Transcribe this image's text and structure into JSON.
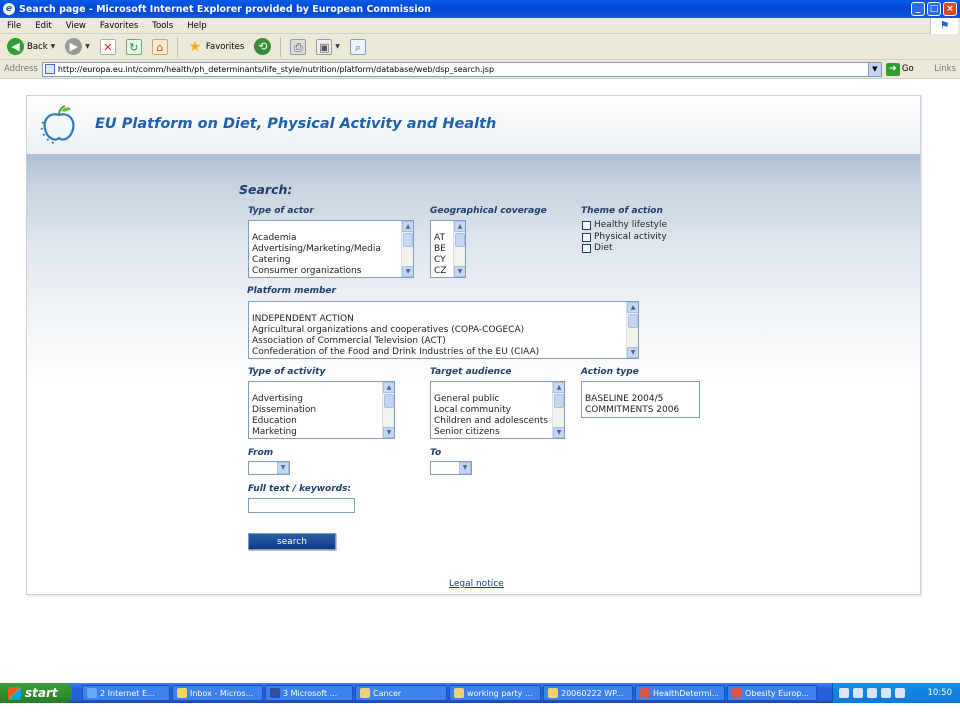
{
  "window": {
    "title": "Search page - Microsoft Internet Explorer provided by European Commission",
    "controls": [
      "_",
      "□",
      "×"
    ]
  },
  "menu": [
    "File",
    "Edit",
    "View",
    "Favorites",
    "Tools",
    "Help"
  ],
  "toolbar": {
    "back_label": "Back",
    "favorites_label": "Favorites"
  },
  "address": {
    "label": "Address",
    "url": "http://europa.eu.int/comm/health/ph_determinants/life_style/nutrition/platform/database/web/dsp_search.jsp",
    "go_label": "Go",
    "links_label": "Links"
  },
  "page": {
    "site_title": "EU Platform on Diet, Physical Activity and Health",
    "search_heading": "Search:",
    "type_of_actor": {
      "label": "Type of actor",
      "options": [
        "",
        "Academia",
        "Advertising/Marketing/Media",
        "Catering",
        "Consumer organizations"
      ]
    },
    "geographical_coverage": {
      "label": "Geographical coverage",
      "options": [
        "",
        "AT",
        "BE",
        "CY",
        "CZ"
      ]
    },
    "theme_of_action": {
      "label": "Theme of action",
      "options": [
        "Healthy lifestyle",
        "Physical activity",
        "Diet"
      ]
    },
    "platform_member": {
      "label": "Platform member",
      "options": [
        "",
        "INDEPENDENT ACTION",
        "Agricultural organizations and cooperatives (COPA-COGECA)",
        "Association of Commercial Television (ACT)",
        "Confederation of the Food and Drink Industries of the EU (CIAA)"
      ]
    },
    "type_of_activity": {
      "label": "Type of activity",
      "options": [
        "",
        "Advertising",
        "Dissemination",
        "Education",
        "Marketing"
      ]
    },
    "target_audience": {
      "label": "Target audience",
      "options": [
        "",
        "General public",
        "Local community",
        "Children and adolescents",
        "Senior citizens"
      ]
    },
    "action_type": {
      "label": "Action type",
      "options": [
        "",
        "BASELINE 2004/5",
        "COMMITMENTS 2006"
      ]
    },
    "from_label": "From",
    "from_value": "",
    "to_label": "To",
    "to_value": "",
    "fulltext_label": "Full text / keywords:",
    "fulltext_value": "",
    "search_button": "search",
    "legal_notice": "Legal notice"
  },
  "taskbar": {
    "start_label": "start",
    "tasks": [
      "2 Internet E...",
      "Inbox - Micros...",
      "3 Microsoft ...",
      "Cancer",
      "working party ...",
      "20060222 WP...",
      "HealthDetermi...",
      "Obesity Europ..."
    ],
    "clock": "10:50"
  }
}
